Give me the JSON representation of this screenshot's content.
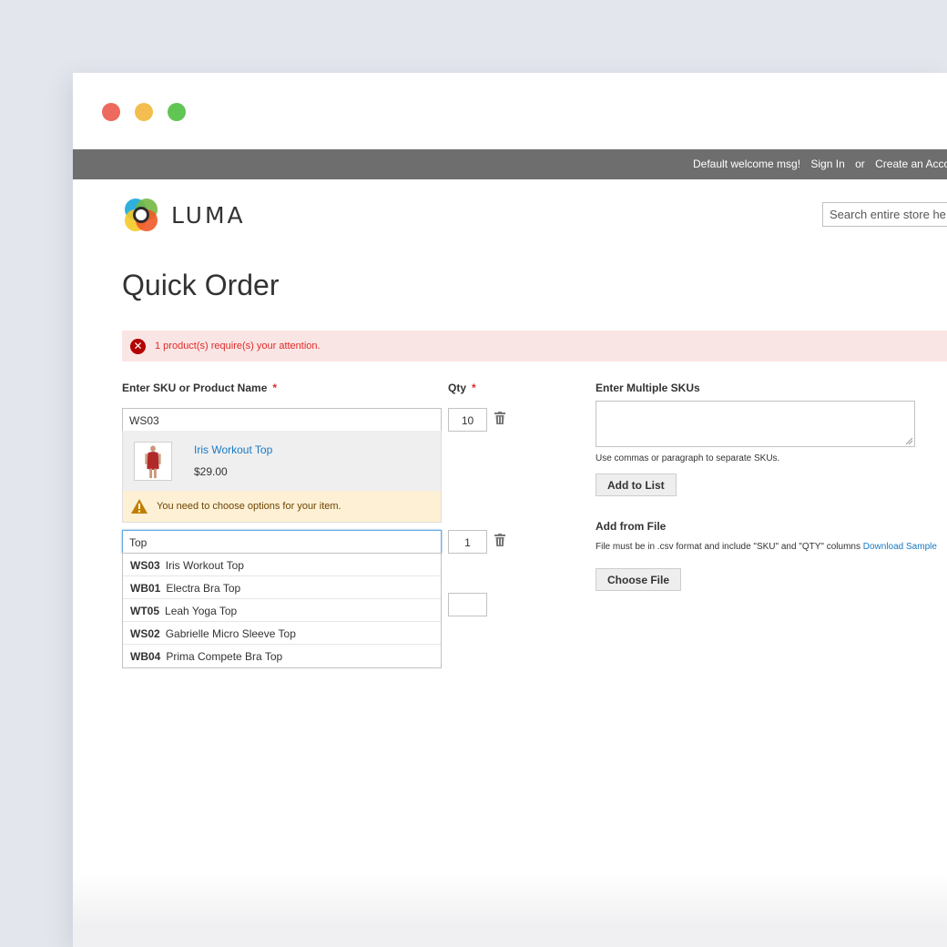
{
  "topbar": {
    "welcome": "Default welcome msg!",
    "sign_in": "Sign In",
    "or": "or",
    "create_account": "Create an Accou"
  },
  "logo": {
    "text": "LUMA"
  },
  "search": {
    "placeholder": "Search entire store he"
  },
  "page": {
    "title": "Quick Order"
  },
  "error": {
    "message": "1 product(s) require(s) your attention."
  },
  "form": {
    "sku_label": "Enter SKU or Product Name",
    "qty_label": "Qty",
    "required_mark": "*",
    "rows": [
      {
        "sku": "WS03",
        "qty": "10"
      },
      {
        "sku": "Top",
        "qty": "1"
      },
      {
        "sku": "",
        "qty": ""
      }
    ]
  },
  "product": {
    "name": "Iris Workout Top",
    "price": "$29.00",
    "warning": "You need to choose options for your item."
  },
  "autocomplete": [
    {
      "sku": "WS03",
      "name": "Iris Workout Top"
    },
    {
      "sku": "WB01",
      "name": "Electra Bra Top"
    },
    {
      "sku": "WT05",
      "name": "Leah Yoga Top"
    },
    {
      "sku": "WS02",
      "name": "Gabrielle Micro Sleeve Top"
    },
    {
      "sku": "WB04",
      "name": "Prima Compete Bra Top"
    }
  ],
  "multiple": {
    "title": "Enter Multiple SKUs",
    "hint": "Use commas or paragraph to separate SKUs.",
    "add_button": "Add to List"
  },
  "file": {
    "title": "Add from File",
    "hint": "File must be in .csv format and include \"SKU\" and \"QTY\" columns",
    "download_link": "Download Sample",
    "choose_button": "Choose File"
  },
  "colors": {
    "link": "#1979c3",
    "error_bg": "#fae5e5",
    "error_text": "#e02b27",
    "warning_bg": "#fdf0d5",
    "topbar_bg": "#6e6e6e"
  }
}
